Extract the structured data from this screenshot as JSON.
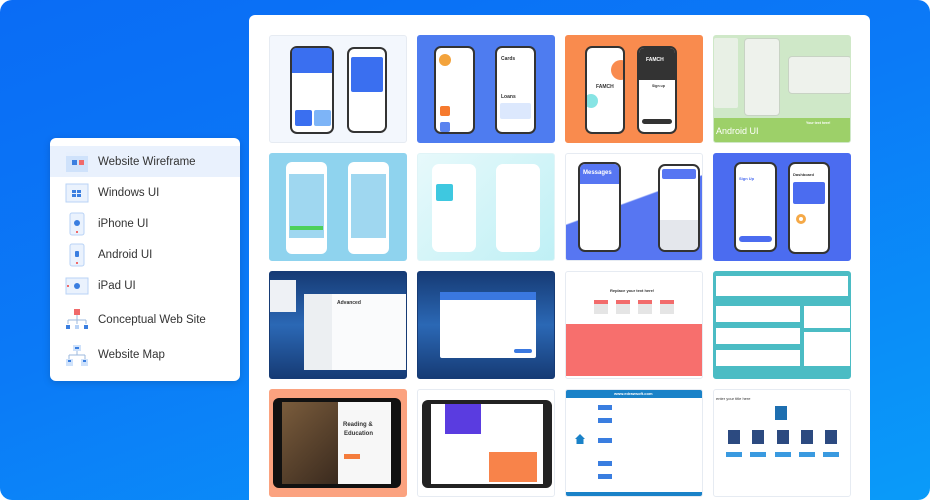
{
  "colors": {
    "background_start": "#0a6cf5",
    "background_end": "#0a9bf9",
    "panel": "#ffffff",
    "sidebar_active": "#e9f1fd"
  },
  "sidebar": {
    "items": [
      {
        "label": "Website Wireframe",
        "icon": "website-wireframe-icon",
        "active": true
      },
      {
        "label": "Windows UI",
        "icon": "windows-ui-icon",
        "active": false
      },
      {
        "label": "iPhone UI",
        "icon": "iphone-ui-icon",
        "active": false
      },
      {
        "label": "Android UI",
        "icon": "android-ui-icon",
        "active": false
      },
      {
        "label": "iPad UI",
        "icon": "ipad-ui-icon",
        "active": false
      },
      {
        "label": "Conceptual Web Site",
        "icon": "conceptual-web-site-icon",
        "active": false
      },
      {
        "label": "Website Map",
        "icon": "website-map-icon",
        "active": false
      }
    ]
  },
  "templates": [
    {
      "name": "finance-app-template",
      "bg": "#f3f7fd"
    },
    {
      "name": "cards-loans-app-template",
      "bg": "#4e7cf0",
      "text": [
        "Cards",
        "Loans"
      ]
    },
    {
      "name": "famch-signup-template",
      "bg": "#f98b4e",
      "text": [
        "FAMCH",
        "FAMCH",
        "Sign up"
      ]
    },
    {
      "name": "android-ui-template",
      "bg": "#cfe8c8",
      "text": [
        "Android UI",
        "Your text here!"
      ]
    },
    {
      "name": "iphone-dialer-template",
      "bg": "#8fd3ee"
    },
    {
      "name": "shop-app-template",
      "bg": "#e7f9fb"
    },
    {
      "name": "messages-app-template",
      "bg": "#ffffff",
      "text": [
        "Messages"
      ]
    },
    {
      "name": "signup-dashboard-template",
      "bg": "#4b6cf0",
      "text": [
        "Sign Up",
        "Dashboard"
      ]
    },
    {
      "name": "windows-advanced-settings-template",
      "bg": "#1f4a8a",
      "text": [
        "Advanced"
      ]
    },
    {
      "name": "windows-dialog-template",
      "bg": "#1f4a8a"
    },
    {
      "name": "landing-page-wireframe-template",
      "bg": "#ffffff",
      "text": [
        "Replace your text here!"
      ]
    },
    {
      "name": "video-site-wireframe-template",
      "bg": "#4bbcc4"
    },
    {
      "name": "reading-education-ipad-template",
      "bg": "#fba27f",
      "text": [
        "Reading &",
        "Education"
      ]
    },
    {
      "name": "ipad-dashboard-template",
      "bg": "#ffffff"
    },
    {
      "name": "conceptual-website-template",
      "bg": "#ffffff",
      "text": [
        "www.edrawsoft.com"
      ]
    },
    {
      "name": "website-map-template",
      "bg": "#ffffff",
      "text": [
        "enter your title here"
      ]
    }
  ]
}
